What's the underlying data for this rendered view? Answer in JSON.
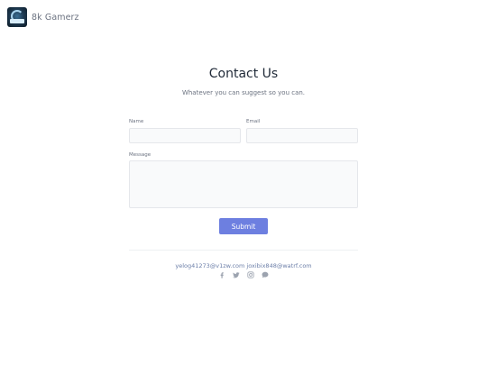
{
  "header": {
    "brand_name": "8k Gamerz",
    "logo_icon": "8k-gamerz-logo-icon"
  },
  "contact": {
    "title": "Contact Us",
    "subtitle": "Whatever you can suggest so you can.",
    "name_label": "Name",
    "email_label": "Email",
    "message_label": "Message",
    "submit_label": "Submit"
  },
  "footer": {
    "emails": "yelog41273@v1zw.com joxibix848@watrf.com",
    "social_icons": [
      "facebook-icon",
      "twitter-icon",
      "instagram-icon",
      "chat-icon"
    ]
  },
  "colors": {
    "accent": "#6d7fe0",
    "link": "#6b7ea8",
    "field_bg": "#f9fafb"
  }
}
